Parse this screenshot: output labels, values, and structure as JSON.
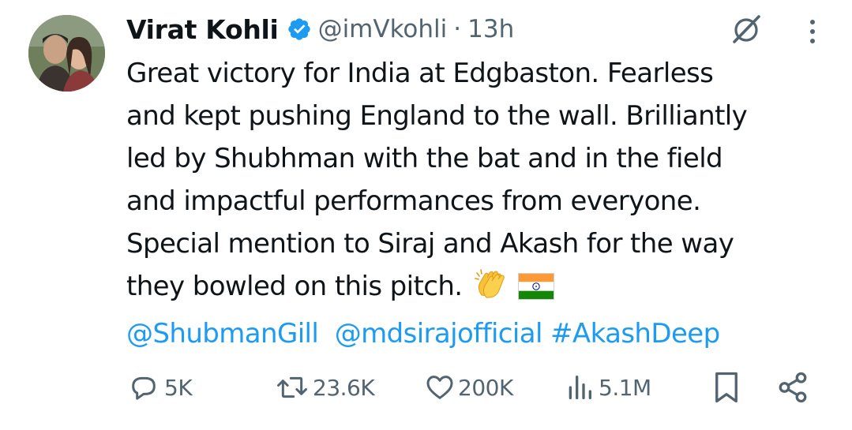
{
  "author": {
    "name": "Virat Kohli",
    "handle": "@imVkohli",
    "separator": "·",
    "time": "13h"
  },
  "tweet": {
    "lines": [
      "Great victory for India at Edgbaston. Fearless",
      "and kept pushing England to the wall. Brilliantly",
      "led by Shubhman with the bat and in the field",
      "and impactful performances from everyone.",
      "Special mention to Siraj and Akash for the way",
      "they bowled on this pitch."
    ],
    "emojis": [
      "clapping-hands",
      "india-flag"
    ],
    "mentions": [
      "@ShubmanGill",
      "@mdsirajofficial",
      "#AkashDeep"
    ]
  },
  "actions": {
    "replies": "5K",
    "reposts": "23.6K",
    "likes": "200K",
    "views": "5.1M"
  },
  "colors": {
    "text": "#0f1419",
    "secondary": "#536471",
    "link": "#1d9bf0",
    "verified": "#1d9bf0"
  }
}
